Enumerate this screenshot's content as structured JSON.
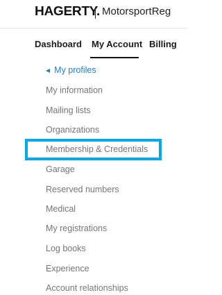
{
  "header": {
    "brand": "HAGERTY.",
    "site_name": "MotorsportReg"
  },
  "tabs": [
    {
      "label": "Dashboard"
    },
    {
      "label": "My Account",
      "active": true
    },
    {
      "label": "Billing"
    }
  ],
  "menu": {
    "back_label": "My profiles",
    "back_icon": "triangle-left-icon",
    "items": [
      {
        "label": "My information"
      },
      {
        "label": "Mailing lists"
      },
      {
        "label": "Organizations"
      },
      {
        "label": "Membership & Credentials",
        "highlighted": true
      },
      {
        "label": "Garage"
      },
      {
        "label": "Reserved numbers"
      },
      {
        "label": "Medical"
      },
      {
        "label": "My registrations"
      },
      {
        "label": "Log books"
      },
      {
        "label": "Experience"
      },
      {
        "label": "Account relationships"
      }
    ]
  },
  "colors": {
    "link": "#1e7fd8",
    "menu_text": "#767676",
    "highlight": "#00a8ee"
  }
}
